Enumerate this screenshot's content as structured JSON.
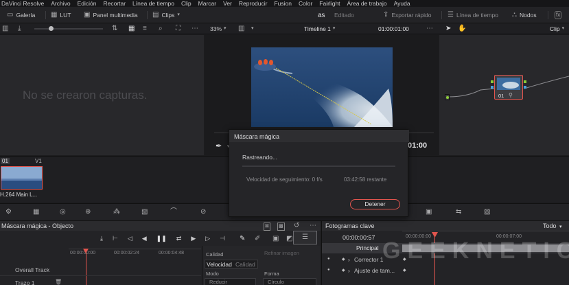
{
  "menubar": {
    "items": [
      "DaVinci Resolve",
      "Archivo",
      "Edición",
      "Recortar",
      "Línea de tiempo",
      "Clip",
      "Marcar",
      "Ver",
      "Reproducir",
      "Fusion",
      "Color",
      "Fairlight",
      "Área de trabajo",
      "Ayuda"
    ]
  },
  "toolbar": {
    "galeria": "Galería",
    "lut": "LUT",
    "panel_multimedia": "Panel multimedia",
    "clips": "Clips",
    "project": "as",
    "project_status": "Editado",
    "exportar": "Exportar rápido",
    "linea_tiempo": "Línea de tiempo",
    "nodos": "Nodos"
  },
  "viewer_bar": {
    "zoom": "33%",
    "timeline": "Timeline 1",
    "timecode": "01:00:01:00",
    "mode": "Clip"
  },
  "gallery": {
    "empty_text": "No se crearon capturas."
  },
  "viewer": {
    "timecode_bottom": "01:00"
  },
  "node": {
    "label": "01"
  },
  "clips": {
    "index": "01",
    "track": "V1",
    "clip_name": "H.264 Main L..."
  },
  "dialog": {
    "title": "Máscara mágica",
    "status": "Rastreando...",
    "speed": "Velocidad de seguimiento: 0 f/s",
    "remaining": "03:42:58 restante",
    "stop_button": "Detener"
  },
  "mask_panel": {
    "title": "Máscara mágica - Objecto",
    "ruler": [
      "00:00:00:00",
      "00:00:02:24",
      "00:00:04:48"
    ],
    "tracks": [
      "Overall Track",
      "Trazo 1"
    ],
    "calidad_label": "Calidad",
    "tab_velocidad": "Velocidad",
    "tab_calidad": "Calidad",
    "refinar": "Refinar imagen",
    "modo_label": "Modo",
    "modo_value": "Reducir",
    "forma_label": "Forma",
    "forma_value": "Círculo"
  },
  "keyframes": {
    "title": "Fotogramas clave",
    "filter": "Todo",
    "timecode": "00:00:00:57",
    "ruler": [
      "00:00:00:00",
      "00:00:07:00"
    ],
    "rows": [
      "Principal",
      "Corrector 1",
      "Ajuste de tam..."
    ]
  },
  "colors": {
    "accent_red": "#e2554e",
    "bg_panel": "#28282b",
    "node_green": "#8ccc3a"
  },
  "watermark": "GEEKNETIC"
}
